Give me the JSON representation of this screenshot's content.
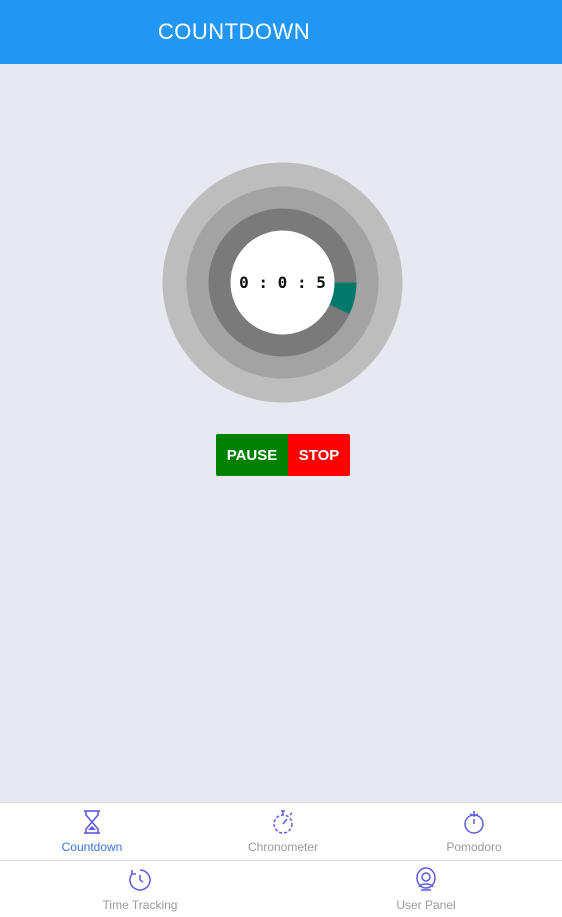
{
  "header": {
    "title": "COUNTDOWN"
  },
  "timer": {
    "display": "0 : 0 : 5",
    "progress_fraction": 0.07,
    "progress_color": "#00796b"
  },
  "controls": {
    "pause_label": "PAUSE",
    "stop_label": "STOP"
  },
  "nav": {
    "items": [
      {
        "label": "Countdown",
        "icon": "hourglass-icon",
        "active": true
      },
      {
        "label": "Chronometer",
        "icon": "stopwatch-icon",
        "active": false
      },
      {
        "label": "Pomodoro",
        "icon": "tomato-icon",
        "active": false
      },
      {
        "label": "Time Tracking",
        "icon": "clock-icon",
        "active": false
      },
      {
        "label": "User Panel",
        "icon": "user-icon",
        "active": false
      }
    ]
  },
  "colors": {
    "header": "#2196f3",
    "pause": "#008000",
    "stop": "#ff0000",
    "active_nav": "#3a74e0",
    "icon": "#5c5ce0"
  }
}
